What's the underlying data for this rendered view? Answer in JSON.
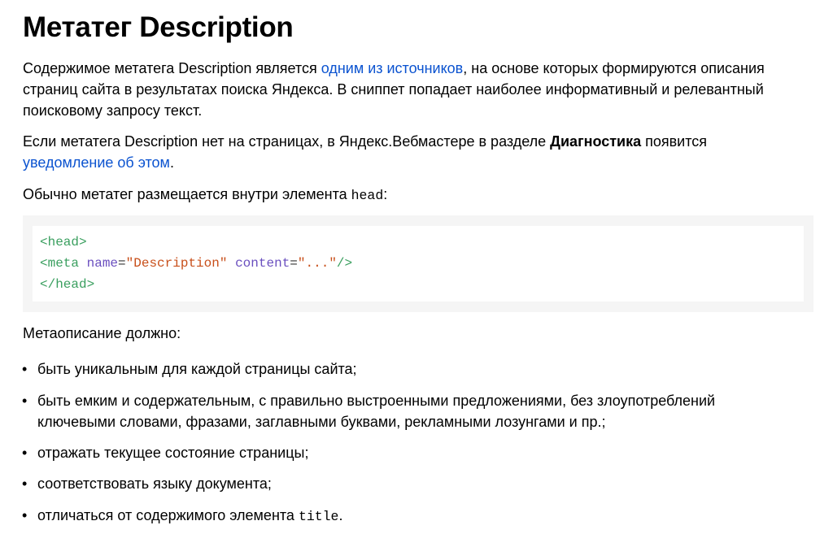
{
  "title": "Метатег Description",
  "para1": {
    "before": "Содержимое метатега Description является ",
    "link": "одним из источников",
    "after_line1": ", на основе которых формируются описания",
    "line2": "страниц сайта в результатах поиска Яндекса. В сниппет попадает наиболее информативный и релевантный",
    "line3": "поисковому запросу текст."
  },
  "para2": {
    "before": "Если метатега Description нет на страницах, в Яндекс.Вебмастере в разделе ",
    "bold": "Диагностика",
    "after": " появится",
    "link": "уведомление об этом",
    "end": "."
  },
  "para3": {
    "text": "Обычно метатег размещается внутри элемента ",
    "code": "head",
    "end": ":"
  },
  "code_block": {
    "line1": {
      "open": "<head>"
    },
    "line2": {
      "tag_open": "<meta",
      "attr1": "name",
      "eq1": "=",
      "val1": "\"Description\"",
      "attr2": "content",
      "eq2": "=",
      "val2": "\"...\"",
      "close": "/>"
    },
    "line3": {
      "close": "</head>"
    }
  },
  "list_intro": "Метаописание должно:",
  "bullet_char": "•",
  "list": {
    "item1": "быть уникальным для каждой страницы сайта;",
    "item2_line1": "быть емким и содержательным, с правильно выстроенными предложениями, без злоупотреблений",
    "item2_line2": "ключевыми словами, фразами, заглавными буквами, рекламными лозунгами и пр.;",
    "item3": "отражать текущее состояние страницы;",
    "item4": "соответствовать языку документа;",
    "item5_text": "отличаться от содержимого элемента ",
    "item5_code": "title",
    "item5_end": "."
  },
  "colors": {
    "link": "#0b53d0",
    "code_tag": "#3a9f5f",
    "code_attr": "#6a4fbf",
    "code_string": "#c84f1a",
    "code_bg": "#f5f5f5"
  }
}
